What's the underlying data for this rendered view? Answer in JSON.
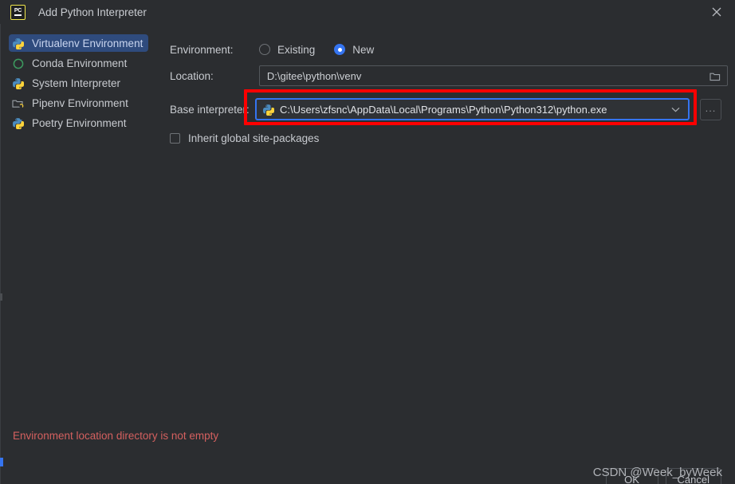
{
  "window": {
    "title": "Add Python Interpreter",
    "app_icon": "pycharm-logo-icon",
    "logo_text": "PC",
    "close_icon": "close-icon"
  },
  "sidebar": {
    "items": [
      {
        "label": "Virtualenv Environment",
        "icon": "virtualenv-python-icon",
        "selected": true
      },
      {
        "label": "Conda Environment",
        "icon": "conda-circle-icon",
        "selected": false
      },
      {
        "label": "System Interpreter",
        "icon": "python-icon",
        "selected": false
      },
      {
        "label": "Pipenv Environment",
        "icon": "pipenv-folder-icon",
        "selected": false
      },
      {
        "label": "Poetry Environment",
        "icon": "poetry-python-icon",
        "selected": false
      }
    ]
  },
  "form": {
    "environment": {
      "label": "Environment:",
      "options": [
        {
          "label": "Existing",
          "selected": false
        },
        {
          "label": "New",
          "selected": true
        }
      ]
    },
    "location": {
      "label": "Location:",
      "value": "D:\\gitee\\python\\venv",
      "placeholder": "",
      "browse_icon": "folder-icon"
    },
    "base_interpreter": {
      "label": "Base interpreter:",
      "value": "C:\\Users\\zfsnc\\AppData\\Local\\Programs\\Python\\Python312\\python.exe",
      "item_icon": "python-icon",
      "dropdown_icon": "chevron-down-icon",
      "browse_button_label": "...",
      "highlighted": true,
      "highlight_color": "#fe0000"
    },
    "inherit": {
      "label": "Inherit global site-packages",
      "checked": false
    }
  },
  "status": {
    "error_message": "Environment location directory is not empty",
    "error_color": "#d4605f"
  },
  "footer": {
    "buttons": [
      {
        "label": "OK"
      },
      {
        "label": "Cancel"
      }
    ]
  },
  "watermark": {
    "text": "CSDN @Week_byWeek"
  },
  "colors": {
    "background": "#2b2d30",
    "selection": "#2f4b7d",
    "accent": "#3574f0",
    "annotation": "#fe0000"
  }
}
